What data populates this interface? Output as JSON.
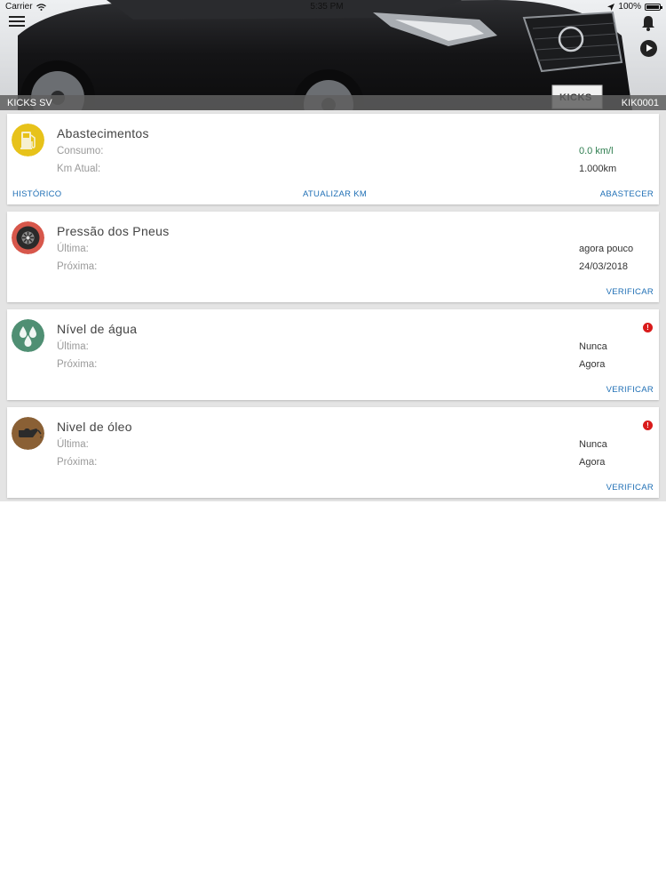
{
  "statusbar": {
    "carrier": "Carrier",
    "time": "5:35 PM",
    "battery": "100%"
  },
  "hero": {
    "model_left": "KICKS SV",
    "model_right": "KIK0001",
    "plate_text": "KICKS"
  },
  "cards": {
    "fuel": {
      "title": "Abastecimentos",
      "row1_label": "Consumo:",
      "row1_value": "0.0 km/l",
      "row2_label": "Km Atual:",
      "row2_value": "1.000km",
      "action_left": "HISTÓRICO",
      "action_mid": "ATUALIZAR KM",
      "action_right": "ABASTECER",
      "icon_color": "#e7c21a"
    },
    "tires": {
      "title": "Pressão dos Pneus",
      "row1_label": "Última:",
      "row1_value": "agora pouco",
      "row2_label": "Próxima:",
      "row2_value": "24/03/2018",
      "action_right": "VERIFICAR",
      "icon_color": "#d7574b"
    },
    "water": {
      "title": "Nível de água",
      "row1_label": "Última:",
      "row1_value": "Nunca",
      "row2_label": "Próxima:",
      "row2_value": "Agora",
      "action_right": "VERIFICAR",
      "alert": "!",
      "icon_color": "#4f8f73"
    },
    "oil": {
      "title": "Nivel de óleo",
      "row1_label": "Última:",
      "row1_value": "Nunca",
      "row2_label": "Próxima:",
      "row2_value": "Agora",
      "action_right": "VERIFICAR",
      "alert": "!",
      "icon_color": "#8a6035"
    }
  },
  "colors": {
    "accent": "#1f6fb5",
    "alert": "#d91b1b",
    "background": "#e4e4e4"
  }
}
